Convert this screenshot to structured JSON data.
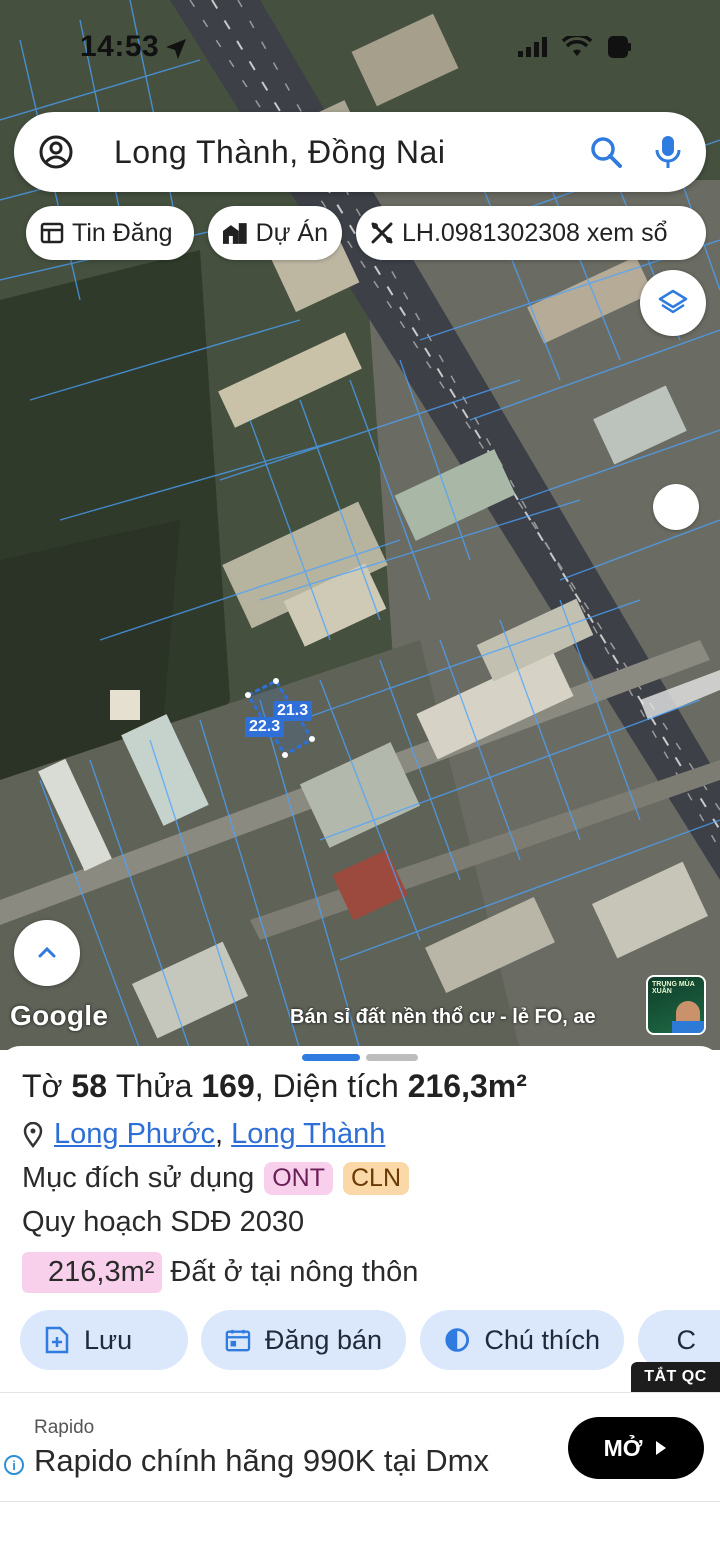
{
  "status_bar": {
    "time": "14:53"
  },
  "search": {
    "query": "Long Thành, Đồng Nai"
  },
  "chips": [
    {
      "label": "Tin Đăng",
      "icon": "listing-icon"
    },
    {
      "label": "Dự Án",
      "icon": "building-icon"
    },
    {
      "label": "LH.0981302308 xem sổ",
      "icon": "tools-icon"
    }
  ],
  "map": {
    "attribution": "Google",
    "marquee": "Bán sỉ đất nền thổ cư - lẻ FO, ae",
    "thumbnail_title": "TRUNG MÙA XUÂN",
    "plot_dimensions": {
      "side_a": "21.3",
      "side_b": "22.3"
    }
  },
  "parcel": {
    "title_prefix_label": "Tờ",
    "sheet_no": "58",
    "plot_label": "Thửa",
    "plot_no": "169",
    "area_label": "Diện tích",
    "area_value": "216,3m²",
    "ward": "Long Phước",
    "district": "Long Thành",
    "separator": ",",
    "purpose_label": "Mục đích sử dụng",
    "purpose_tags": [
      "ONT",
      "CLN"
    ],
    "plan_label": "Quy hoạch SDĐ 2030",
    "area_badge": "216,3m²",
    "area_type": "Đất ở tại nông thôn"
  },
  "actions": [
    {
      "label": "Lưu",
      "icon": "save-icon"
    },
    {
      "label": "Đăng bán",
      "icon": "post-icon"
    },
    {
      "label": "Chú thích",
      "icon": "legend-icon"
    },
    {
      "label": "C",
      "icon": "camera-icon"
    }
  ],
  "ad": {
    "close_label": "TẮT QC",
    "advertiser": "Rapido",
    "headline": "Rapido chính hãng 990K tại Dmx",
    "cta": "MỞ"
  },
  "colors": {
    "accent": "#2f7be0",
    "chip_bg": "#dbe7fb",
    "tag_ont": "#f9d0ec",
    "tag_cln": "#fbd8a8"
  }
}
